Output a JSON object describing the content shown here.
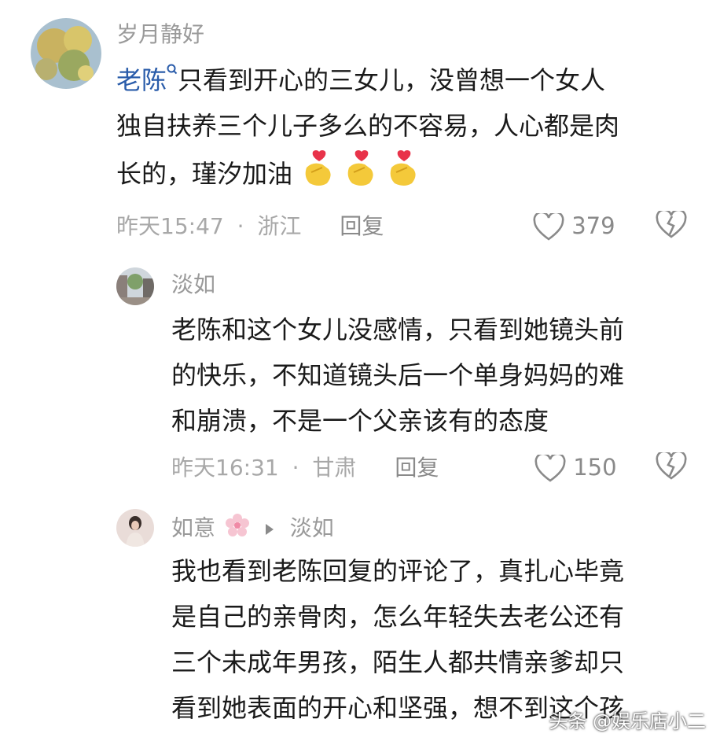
{
  "comments": [
    {
      "username": "岁月静好",
      "mention": "老陈",
      "lines": [
        "只看到开心的三女儿，没曾想一个女人",
        "独自扶养三个儿子多么的不容易，人心都是肉",
        "长的，瑾汐加油"
      ],
      "emoji_icon": "heart-hand-emoji",
      "time": "昨天15:47",
      "separator": "·",
      "location": "浙江",
      "reply_label": "回复",
      "likes": "379"
    },
    {
      "username": "淡如",
      "lines": [
        "老陈和这个女儿没感情，只看到她镜头前",
        "的快乐，不知道镜头后一个单身妈妈的难",
        "和崩溃，不是一个父亲该有的态度"
      ],
      "time": "昨天16:31",
      "separator": "·",
      "location": "甘肃",
      "reply_label": "回复",
      "likes": "150"
    },
    {
      "username": "如意",
      "flower_icon": "cherry-blossom-emoji",
      "arrow_icon": "play-arrow-icon",
      "reply_to": "淡如",
      "lines": [
        "我也看到老陈回复的评论了，真扎心毕竟",
        "是自己的亲骨肉，怎么年轻失去老公还有",
        "三个未成年男孩，陌生人都共情亲爹却只",
        "看到她表面的开心和坚强，想不到这个孩"
      ]
    }
  ],
  "watermark": "头条 @娱乐店小二",
  "colors": {
    "mention": "#2a5caa",
    "muted": "#9a9a9a",
    "text": "#1a1a1a",
    "heart_emoji": "#f4c93a"
  }
}
